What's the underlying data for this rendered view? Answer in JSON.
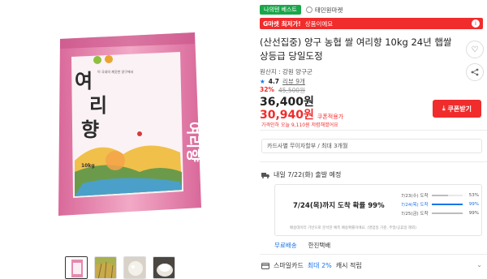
{
  "gallery": {
    "bag": {
      "brand_top": "이 국내의 깨끗한 양구에서",
      "name_chars": [
        "여",
        "리",
        "향"
      ],
      "side_name": "여리향",
      "weight": "10kg",
      "bag_color": "#e07aa0"
    },
    "thumbnails": [
      "product-bag",
      "rice-field",
      "rice-grains",
      "cooked-rice"
    ]
  },
  "product": {
    "badge": "나의텐 베스트",
    "seller": "태민원마켓",
    "promo": {
      "brand": "G마켓 최저가!",
      "text": "상품이에요"
    },
    "title": "(산선집중) 양구 농협 쌀 여리향 10kg 24년 햅쌀 상등급 당일도정",
    "origin": "원산지 : 강원 양구군",
    "rating": {
      "score": "4.7",
      "reviews": "리뷰 9개"
    },
    "discount": "32%",
    "original_price": "45,500원",
    "price": "36,400원",
    "coupon_price": "30,940원",
    "coupon_price_label": "쿠폰적용가",
    "coupon_button": "쿠폰받기",
    "warning": "가격인하 오늘 9,110원 저렴해졌어요",
    "card_benefit": "카드사별 무이자할부 / 최대 3개월",
    "shipping": {
      "head": "내일 7/22(화) 출발 예정",
      "probability": "7/24(목)까지 도착 확률 99%",
      "rows": [
        {
          "date": "7/23(수) 도착",
          "pct": "53%",
          "value": 0.53
        },
        {
          "date": "7/24(목) 도착",
          "pct": "99%",
          "value": 0.99,
          "highlight": true
        },
        {
          "date": "7/25(금) 도착",
          "pct": "99%",
          "value": 0.99
        }
      ],
      "note": "배송데이터 기반으로 분석한 예측 배송확률이에요. (영업일 기준, 주말/공휴일 제외)",
      "type": "무료배송",
      "carrier": "한진택배"
    },
    "smile": {
      "label": "스마일카드",
      "highlight": "최대 2%",
      "suffix": "캐시 적립"
    }
  },
  "colors": {
    "accent": "#f02c2c",
    "link": "#1a74e8",
    "green": "#1aa64a"
  }
}
